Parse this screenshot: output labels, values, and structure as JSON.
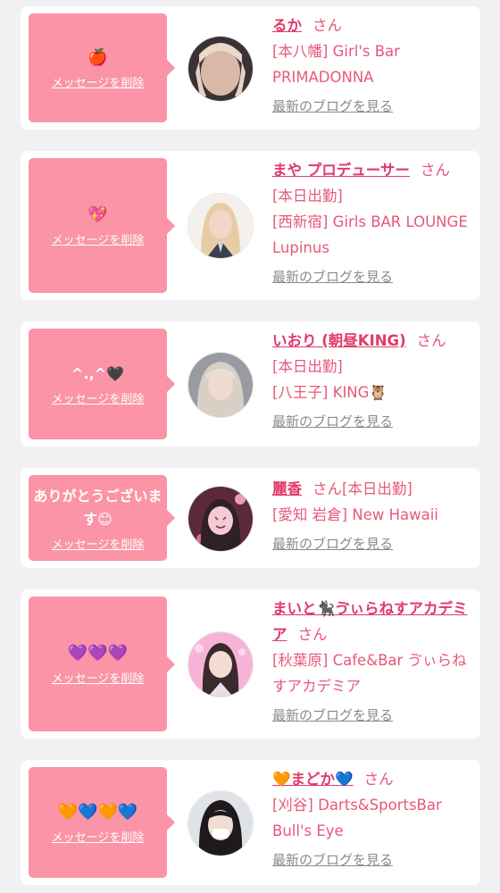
{
  "colors": {
    "background": "#f1f1f3",
    "card": "#ffffff",
    "bubble": "#fa94a6",
    "name": "#e03a6a",
    "detail": "#e8587a",
    "blog_link": "#8a8a8a"
  },
  "delete_label": "メッセージを削除",
  "blog_label": "最新のブログを見る",
  "san_label": "さん",
  "entries": [
    {
      "message": "🍎",
      "name": "るか",
      "status": "",
      "detail": "[本八幡] Girl's Bar PRIMADONNA",
      "has_blog": true
    },
    {
      "message": "💖",
      "name": "まや プロデューサー",
      "status": "[本日出勤]",
      "detail": "[西新宿] Girls BAR LOUNGE Lupinus",
      "has_blog": true
    },
    {
      "message": "^.,^🖤",
      "name": "いおり (朝昼KING)",
      "status": "[本日出勤]",
      "detail": "[八王子] KING🦉",
      "has_blog": true
    },
    {
      "message": "ありがとうございます😊",
      "name": "麗香",
      "status": "[本日出勤]",
      "detail": "[愛知 岩倉] New Hawaii",
      "has_blog": true
    },
    {
      "message": "💜💜💜",
      "name": "まいと🐈‍⬛ゔぃらねすアカデミア",
      "status": "",
      "detail": "[秋葉原] Cafe&Bar ゔぃらねすアカデミア",
      "has_blog": true
    },
    {
      "message": "🧡💙🧡💙",
      "name": "🧡まどか💙",
      "status": "",
      "detail": "[刈谷] Darts&SportsBar Bull's Eye",
      "has_blog": true
    }
  ]
}
